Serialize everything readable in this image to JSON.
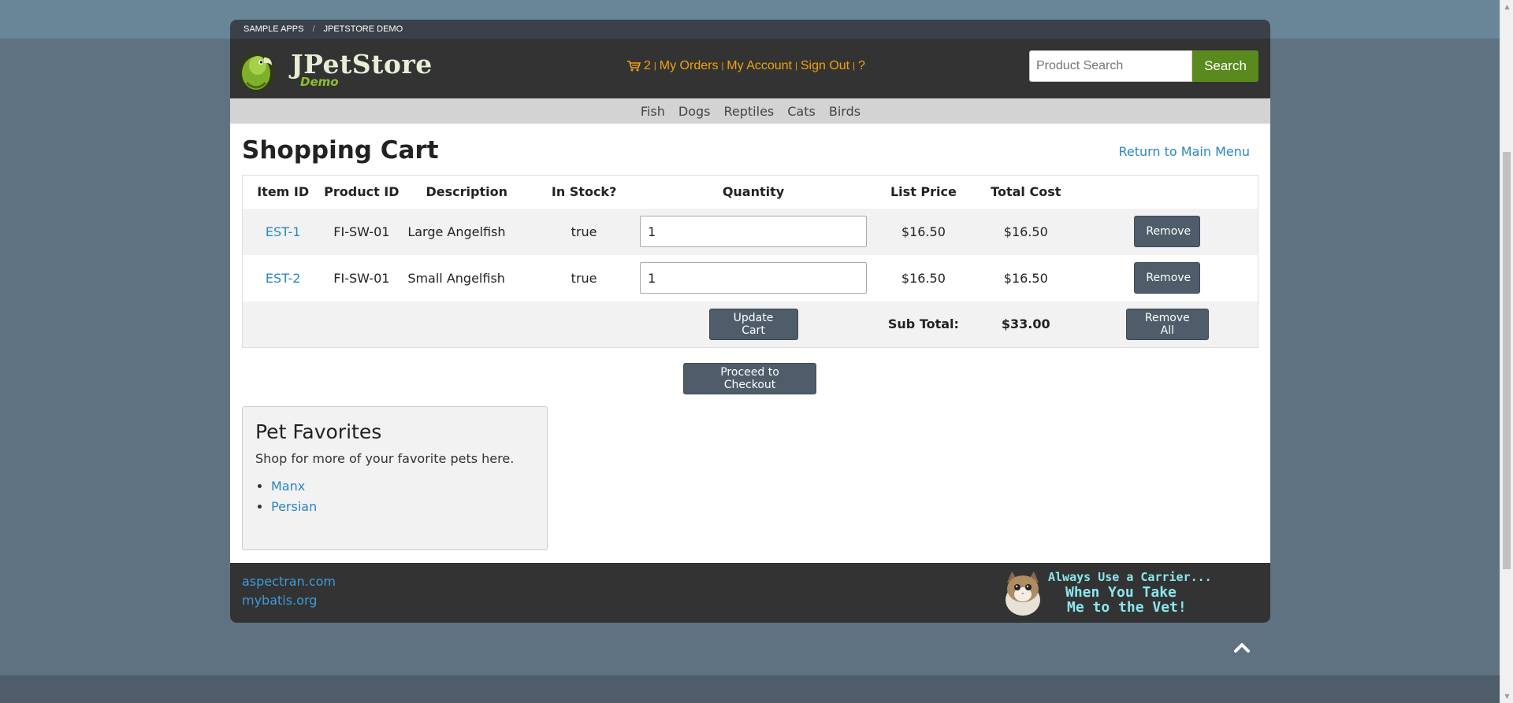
{
  "breadcrumb": {
    "item1": "SAMPLE APPS",
    "separator": "/",
    "item2": "JPETSTORE DEMO"
  },
  "logo": {
    "title": "JPetStore",
    "subtitle": "Demo"
  },
  "menu": {
    "cart_count": "2",
    "orders": "My Orders",
    "account": "My Account",
    "signout": "Sign Out",
    "help": "?",
    "divider": "|"
  },
  "search": {
    "placeholder": "Product Search",
    "button": "Search"
  },
  "categories": [
    "Fish",
    "Dogs",
    "Reptiles",
    "Cats",
    "Birds"
  ],
  "cart": {
    "title": "Shopping Cart",
    "return_link": "Return to Main Menu",
    "headers": [
      "Item ID",
      "Product ID",
      "Description",
      "In Stock?",
      "Quantity",
      "List Price",
      "Total Cost"
    ],
    "rows": [
      {
        "item_id": "EST-1",
        "product_id": "FI-SW-01",
        "description": "Large Angelfish",
        "in_stock": "true",
        "quantity": "1",
        "list_price": "$16.50",
        "total_cost": "$16.50",
        "remove": "Remove"
      },
      {
        "item_id": "EST-2",
        "product_id": "FI-SW-01",
        "description": "Small Angelfish",
        "in_stock": "true",
        "quantity": "1",
        "list_price": "$16.50",
        "total_cost": "$16.50",
        "remove": "Remove"
      }
    ],
    "update_button": "Update Cart",
    "subtotal_label": "Sub Total:",
    "subtotal_value": "$33.00",
    "remove_all_button": "Remove All",
    "checkout_button": "Proceed to Checkout"
  },
  "favorites": {
    "title": "Pet Favorites",
    "text": "Shop for more of your favorite pets here.",
    "items": [
      "Manx",
      "Persian"
    ]
  },
  "footer": {
    "links": [
      "aspectran.com",
      "mybatis.org"
    ],
    "banner_line1": "Always Use a Carrier...",
    "banner_line2": "When You Take",
    "banner_line3": "Me to the Vet!"
  },
  "colors": {
    "accent_link": "#2a86c5",
    "menu_orange": "#f0a30a",
    "search_green": "#5a8a1e",
    "button_slate": "#4e5d69"
  },
  "icons": [
    "cart-icon",
    "parrot-logo-icon",
    "cat-icon",
    "chevron-up-icon"
  ]
}
